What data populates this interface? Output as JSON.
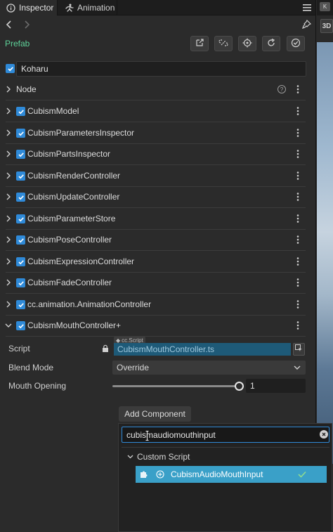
{
  "tabs": [
    {
      "label": "Inspector",
      "icon": "info-icon",
      "active": true
    },
    {
      "label": "Animation",
      "icon": "runner-icon",
      "active": false
    }
  ],
  "viewport": {
    "mode_button": "3D",
    "corner_badge": "K"
  },
  "prefab": {
    "label": "Prefab",
    "tools": [
      "edit-icon",
      "unlink-icon",
      "locate-icon",
      "revert-icon",
      "apply-icon"
    ]
  },
  "node": {
    "name": "Koharu",
    "active": true
  },
  "node_section": {
    "label": "Node",
    "help": "?"
  },
  "components": [
    {
      "label": "CubismModel",
      "enabled": true,
      "expanded": false
    },
    {
      "label": "CubismParametersInspector",
      "enabled": true,
      "expanded": false
    },
    {
      "label": "CubismPartsInspector",
      "enabled": true,
      "expanded": false
    },
    {
      "label": "CubismRenderController",
      "enabled": true,
      "expanded": false
    },
    {
      "label": "CubismUpdateController",
      "enabled": true,
      "expanded": false
    },
    {
      "label": "CubismParameterStore",
      "enabled": true,
      "expanded": false
    },
    {
      "label": "CubismPoseController",
      "enabled": true,
      "expanded": false
    },
    {
      "label": "CubismExpressionController",
      "enabled": true,
      "expanded": false
    },
    {
      "label": "CubismFadeController",
      "enabled": true,
      "expanded": false
    },
    {
      "label": "cc.animation.AnimationController",
      "enabled": true,
      "expanded": false
    },
    {
      "label": "CubismMouthController+",
      "enabled": true,
      "expanded": true
    }
  ],
  "properties": {
    "script": {
      "label": "Script",
      "tag": "cc.Script",
      "value": "CubismMouthController.ts"
    },
    "blend_mode": {
      "label": "Blend Mode",
      "value": "Override"
    },
    "mouth_opening": {
      "label": "Mouth Opening",
      "value": "1",
      "level": 1.0
    }
  },
  "add_component": {
    "label": "Add Component"
  },
  "popup": {
    "search_value": "cubismaudiomouthinput",
    "category": "Custom Script",
    "result": "CubismAudioMouthInput"
  }
}
